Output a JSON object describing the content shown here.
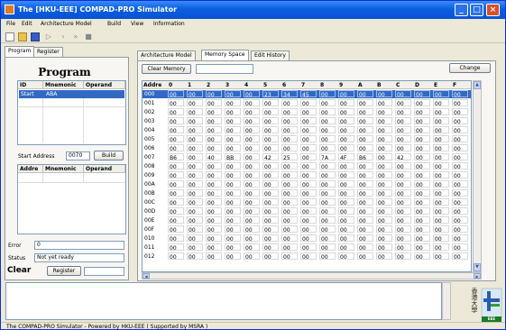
{
  "window": {
    "title": "The [HKU-EEE] COMPAD-PRO Simulator",
    "buttons": {
      "minimize": "_",
      "maximize": "□",
      "close": "×"
    }
  },
  "menu": [
    "File",
    "Edit",
    "Architecture Model",
    "Build",
    "View",
    "Information"
  ],
  "toolbar": {
    "icons": [
      "new-file-icon",
      "open-folder-icon",
      "save-icon",
      "run-icon",
      "step-icon",
      "step-over-icon",
      "stop-icon"
    ],
    "glyphs": {
      "run": "▷",
      "step": "›",
      "step_over": "»",
      "stop": "■"
    }
  },
  "left_tabs": [
    "Program",
    "Register"
  ],
  "program": {
    "title": "Program",
    "columns": [
      "ID",
      "Mnemonic",
      "Operand"
    ],
    "rows": [
      {
        "id": "Start",
        "mnemonic": "ABA",
        "operand": ""
      }
    ],
    "start_address_label": "Start Address",
    "start_address_value": "0070",
    "build_label": "Build",
    "addr_columns": [
      "Addre",
      "Mnemonic",
      "Operand"
    ],
    "error_label": "Error",
    "error_value": "0",
    "status_label": "Status",
    "status_value": "Not yet ready",
    "clear_label": "Clear",
    "clear_register_label": "Register",
    "clear_field_value": ""
  },
  "right_tabs": [
    "Architecture Model",
    "Memory Space",
    "Edit History"
  ],
  "memory": {
    "clear_memory_label": "Clear Memory",
    "input_value": "",
    "change_label": "Change",
    "headers": [
      "Addre",
      "0",
      "1",
      "2",
      "3",
      "4",
      "5",
      "6",
      "7",
      "8",
      "9",
      "A",
      "B",
      "C",
      "D",
      "E",
      "F"
    ],
    "rows": [
      {
        "addr": "000",
        "vals": [
          "00",
          "00",
          "00",
          "00",
          "00",
          "23",
          "34",
          "45",
          "00",
          "00",
          "00",
          "00",
          "00",
          "00",
          "00",
          "00"
        ]
      },
      {
        "addr": "001",
        "vals": [
          "00",
          "00",
          "00",
          "00",
          "00",
          "00",
          "00",
          "00",
          "00",
          "00",
          "00",
          "00",
          "00",
          "00",
          "00",
          "00"
        ]
      },
      {
        "addr": "002",
        "vals": [
          "00",
          "00",
          "00",
          "00",
          "00",
          "00",
          "00",
          "00",
          "00",
          "00",
          "00",
          "00",
          "00",
          "00",
          "00",
          "00"
        ]
      },
      {
        "addr": "003",
        "vals": [
          "00",
          "00",
          "00",
          "00",
          "00",
          "00",
          "00",
          "00",
          "00",
          "00",
          "00",
          "00",
          "00",
          "00",
          "00",
          "00"
        ]
      },
      {
        "addr": "004",
        "vals": [
          "00",
          "00",
          "00",
          "00",
          "00",
          "00",
          "00",
          "00",
          "00",
          "00",
          "00",
          "00",
          "00",
          "00",
          "00",
          "00"
        ]
      },
      {
        "addr": "005",
        "vals": [
          "00",
          "00",
          "00",
          "00",
          "00",
          "00",
          "00",
          "00",
          "00",
          "00",
          "00",
          "00",
          "00",
          "00",
          "00",
          "00"
        ]
      },
      {
        "addr": "006",
        "vals": [
          "00",
          "00",
          "00",
          "00",
          "00",
          "00",
          "00",
          "00",
          "00",
          "00",
          "00",
          "00",
          "00",
          "00",
          "00",
          "00"
        ]
      },
      {
        "addr": "007",
        "vals": [
          "B6",
          "00",
          "40",
          "BB",
          "00",
          "42",
          "25",
          "00",
          "7A",
          "4F",
          "B6",
          "00",
          "42",
          "00",
          "00",
          "00"
        ]
      },
      {
        "addr": "008",
        "vals": [
          "00",
          "00",
          "00",
          "00",
          "00",
          "00",
          "00",
          "00",
          "00",
          "00",
          "00",
          "00",
          "00",
          "00",
          "00",
          "00"
        ]
      },
      {
        "addr": "009",
        "vals": [
          "00",
          "00",
          "00",
          "00",
          "00",
          "00",
          "00",
          "00",
          "00",
          "00",
          "00",
          "00",
          "00",
          "00",
          "00",
          "00"
        ]
      },
      {
        "addr": "00A",
        "vals": [
          "00",
          "00",
          "00",
          "00",
          "00",
          "00",
          "00",
          "00",
          "00",
          "00",
          "00",
          "00",
          "00",
          "00",
          "00",
          "00"
        ]
      },
      {
        "addr": "00B",
        "vals": [
          "00",
          "00",
          "00",
          "00",
          "00",
          "00",
          "00",
          "00",
          "00",
          "00",
          "00",
          "00",
          "00",
          "00",
          "00",
          "00"
        ]
      },
      {
        "addr": "00C",
        "vals": [
          "00",
          "00",
          "00",
          "00",
          "00",
          "00",
          "00",
          "00",
          "00",
          "00",
          "00",
          "00",
          "00",
          "00",
          "00",
          "00"
        ]
      },
      {
        "addr": "00D",
        "vals": [
          "00",
          "00",
          "00",
          "00",
          "00",
          "00",
          "00",
          "00",
          "00",
          "00",
          "00",
          "00",
          "00",
          "00",
          "00",
          "00"
        ]
      },
      {
        "addr": "00E",
        "vals": [
          "00",
          "00",
          "00",
          "00",
          "00",
          "00",
          "00",
          "00",
          "00",
          "00",
          "00",
          "00",
          "00",
          "00",
          "00",
          "00"
        ]
      },
      {
        "addr": "00F",
        "vals": [
          "00",
          "00",
          "00",
          "00",
          "00",
          "00",
          "00",
          "00",
          "00",
          "00",
          "00",
          "00",
          "00",
          "00",
          "00",
          "00"
        ]
      },
      {
        "addr": "010",
        "vals": [
          "00",
          "00",
          "00",
          "00",
          "00",
          "00",
          "00",
          "00",
          "00",
          "00",
          "00",
          "00",
          "00",
          "00",
          "00",
          "00"
        ]
      },
      {
        "addr": "011",
        "vals": [
          "00",
          "00",
          "00",
          "00",
          "00",
          "00",
          "00",
          "00",
          "00",
          "00",
          "00",
          "00",
          "00",
          "00",
          "00",
          "00"
        ]
      },
      {
        "addr": "012",
        "vals": [
          "00",
          "00",
          "00",
          "00",
          "00",
          "00",
          "00",
          "00",
          "00",
          "00",
          "00",
          "00",
          "00",
          "00",
          "00",
          "00"
        ]
      }
    ],
    "selected_row": "000"
  },
  "logo": {
    "name": "hku-eee-logo-icon",
    "caption": "香港大學",
    "mark": "EEE"
  },
  "status_bar": "The COMPAD-PRO Simulator - Powered by HKU-EEE  ( Supported by MSRA )",
  "colors": {
    "title_bar": "#0a5fe0",
    "selection": "#316ac5",
    "window_face": "#ece9d8"
  }
}
